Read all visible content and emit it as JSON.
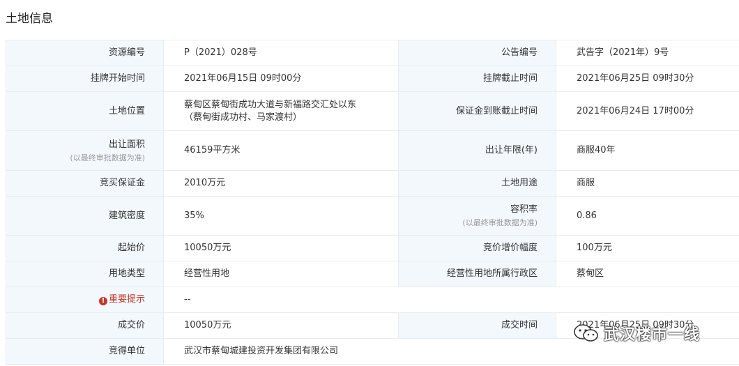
{
  "page_title": "土地信息",
  "rows": [
    {
      "l1": "资源编号",
      "l1s": "",
      "v1": "P（2021）028号",
      "l2": "公告编号",
      "l2s": "",
      "v2": "武告字（2021年）9号"
    },
    {
      "l1": "挂牌开始时间",
      "l1s": "",
      "v1": "2021年06月15日 09时00分",
      "l2": "挂牌截止时间",
      "l2s": "",
      "v2": "2021年06月25日 09时30分"
    },
    {
      "l1": "土地位置",
      "l1s": "",
      "v1": "蔡甸区蔡甸街成功大道与新福路交汇处以东",
      "v1b": "（蔡甸街成功村、马家渡村）",
      "l2": "保证金到账截止时间",
      "l2s": "",
      "v2": "2021年06月24日 17时00分"
    },
    {
      "l1": "出让面积",
      "l1s": "(以最终审批数据为准)",
      "v1": "46159平方米",
      "l2": "出让年限(年)",
      "l2s": "",
      "v2": "商服40年"
    },
    {
      "l1": "竞买保证金",
      "l1s": "",
      "v1": "2010万元",
      "l2": "土地用途",
      "l2s": "",
      "v2": "商服"
    },
    {
      "l1": "建筑密度",
      "l1s": "",
      "v1": "35%",
      "l2": "容积率",
      "l2s": "(以最终审批数据为准)",
      "v2": "0.86"
    },
    {
      "l1": "起始价",
      "l1s": "",
      "v1": "10050万元",
      "l2": "竞价增价幅度",
      "l2s": "",
      "v2": "100万元"
    },
    {
      "l1": "用地类型",
      "l1s": "",
      "v1": "经营性用地",
      "l2": "经营性用地所属行政区",
      "l2s": "",
      "v2": "蔡甸区"
    }
  ],
  "important": {
    "label": "重要提示",
    "value": "--"
  },
  "deal": {
    "l1": "成交价",
    "v1": "10050万元",
    "l2": "成交时间",
    "v2": "2021年06月25日 09时30分"
  },
  "winner": {
    "label": "竞得单位",
    "value": "武汉市蔡甸城建投资开发集团有限公司"
  },
  "watermark": {
    "text": "武汉楼市一线",
    "icon": "wechat-icon"
  }
}
